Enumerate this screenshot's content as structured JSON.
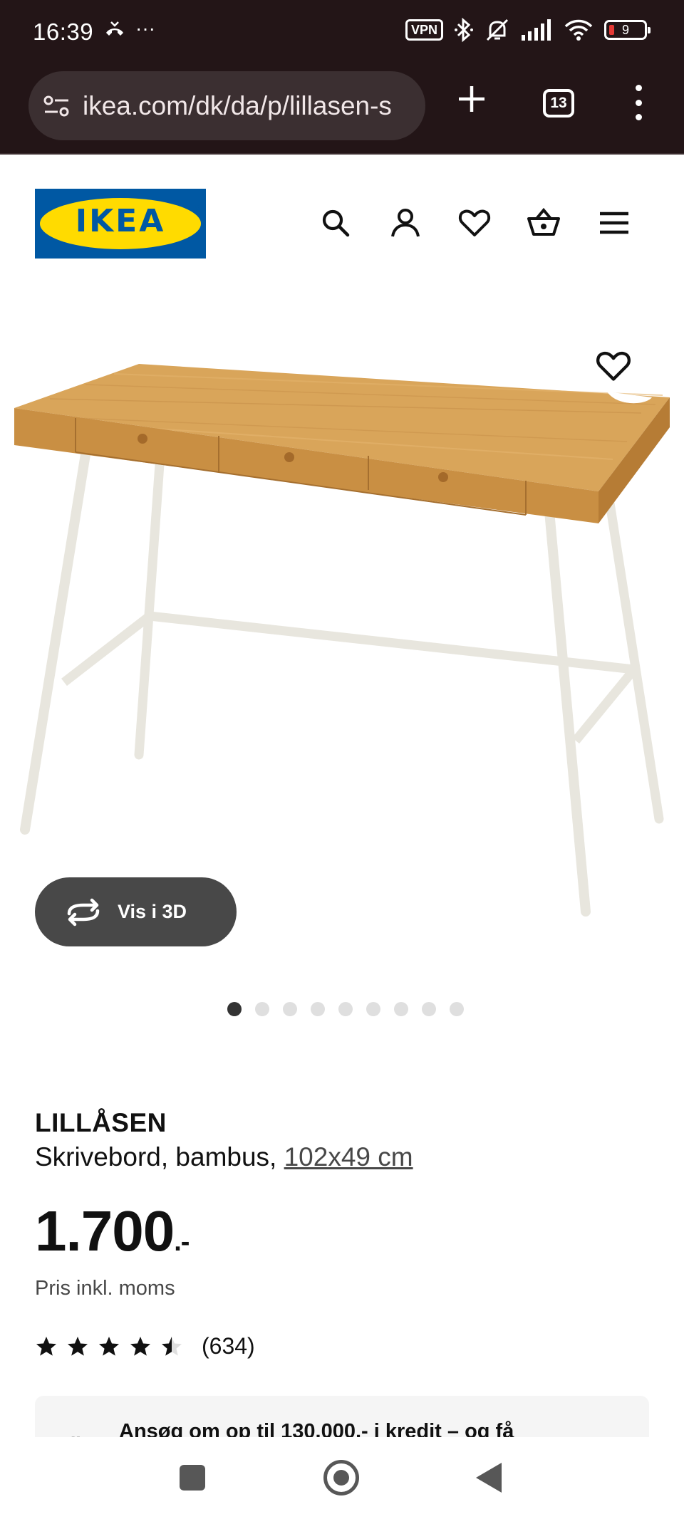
{
  "status_bar": {
    "time": "16:39",
    "left_icons": [
      "missed-call-icon",
      "more-notifications-icon"
    ],
    "more": "···",
    "vpn_label": "VPN",
    "battery_level": "9",
    "icons": [
      "bluetooth-icon",
      "mute-icon",
      "signal-icon",
      "wifi-icon",
      "battery-icon"
    ]
  },
  "browser": {
    "url": "ikea.com/dk/da/p/lillasen-s",
    "tab_count": "13",
    "icons": [
      "site-settings-icon",
      "new-tab-icon",
      "tab-switcher-icon",
      "overflow-menu-icon"
    ]
  },
  "header": {
    "logo_text": "IKEA",
    "icons": [
      "search-icon",
      "account-icon",
      "favorites-icon",
      "basket-icon",
      "menu-icon"
    ]
  },
  "media": {
    "view_3d_label": "Vis i 3D",
    "image_count": 9,
    "active_index": 0
  },
  "product": {
    "name": "LILLÅSEN",
    "description": "Skrivebord, bambus, ",
    "size": "102x49 cm",
    "price": "1.700",
    "price_suffix": ".-",
    "price_note": "Pris inkl. moms",
    "rating_value": 4.5,
    "rating_max": 5,
    "review_count": "(634)"
  },
  "credit": {
    "text": "Ansøg om op til 130.000,- i kredit – og få"
  },
  "colors": {
    "chrome_bg": "#231517",
    "ikea_blue": "#0058a3",
    "ikea_yellow": "#ffdb00",
    "bamboo": "#d9a55a",
    "leg_white": "#e8e6de"
  }
}
